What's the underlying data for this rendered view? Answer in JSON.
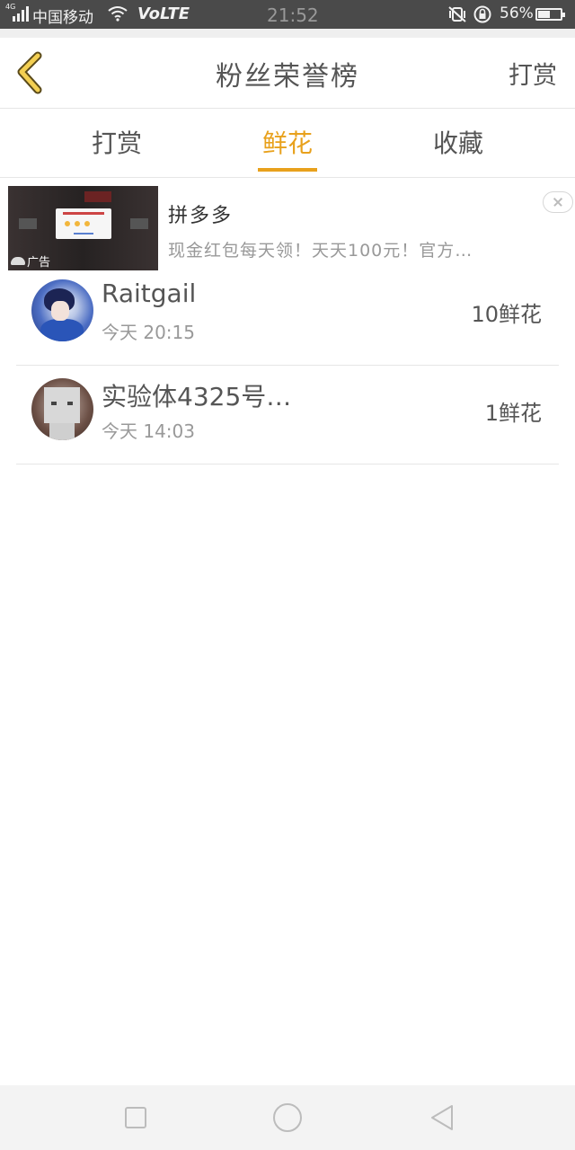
{
  "status_bar": {
    "network_mini": "4G",
    "carrier": "中国移动",
    "volte": "VoLTE",
    "time": "21:52",
    "battery_percent": "56%",
    "battery_level": 0.56
  },
  "nav": {
    "title": "粉丝荣誉榜",
    "right_action": "打赏"
  },
  "tabs": [
    {
      "label": "打赏",
      "active": false
    },
    {
      "label": "鲜花",
      "active": true
    },
    {
      "label": "收藏",
      "active": false
    }
  ],
  "ad": {
    "title": "拼多多",
    "description": "现金红包每天领！天天100元！官方…",
    "badge": "广告"
  },
  "list": [
    {
      "name": "Raitgail",
      "time": "今天 20:15",
      "amount": "10鲜花"
    },
    {
      "name": "实验体4325号…",
      "time": "今天 14:03",
      "amount": "1鲜花"
    }
  ],
  "colors": {
    "accent": "#e8a11c",
    "status_bar_bg": "#4a4a4a",
    "text": "#555555",
    "muted": "#999999"
  }
}
